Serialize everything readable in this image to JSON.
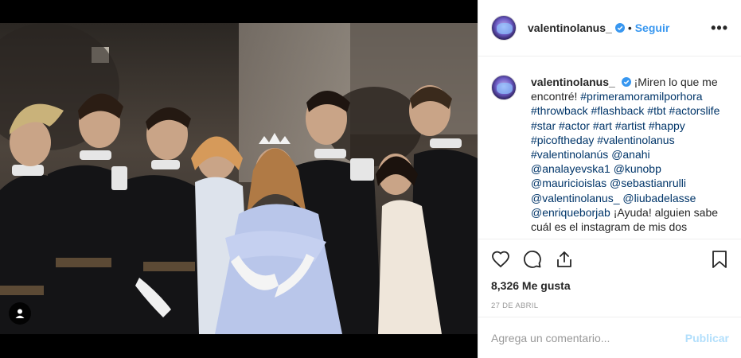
{
  "post": {
    "username": "valentinolanus_",
    "follow_label": "Seguir",
    "caption_intro": "¡Miren lo que me encontré!",
    "caption_tags": "#primeramoramilporhora #throwback #flashback #tbt #actorslife #star #actor #art #artist #happy #picoftheday #valentinolanus #valentinolanús",
    "caption_mentions": "@anahi @analayevska1 @kunobp @mauricioislas @sebastianrulli @valentinolanus_ @liubadelasse @enriqueborjab",
    "caption_tail": "¡Ayuda! alguien sabe cuál es el instagram de mis dos",
    "likes": "8,326 Me gusta",
    "date": "27 DE ABRIL",
    "comment_placeholder": "Agrega un comentario...",
    "publish_label": "Publicar",
    "more_label": "•••"
  },
  "icons": {
    "verified": "verified-badge-icon",
    "like": "heart-icon",
    "comment": "comment-icon",
    "share": "share-icon",
    "save": "bookmark-icon",
    "tag": "user-tag-icon"
  },
  "colors": {
    "link": "#3897f0",
    "hashtag": "#003569",
    "publish_disabled": "#b2dffc",
    "text": "#262626",
    "muted": "#999999"
  }
}
